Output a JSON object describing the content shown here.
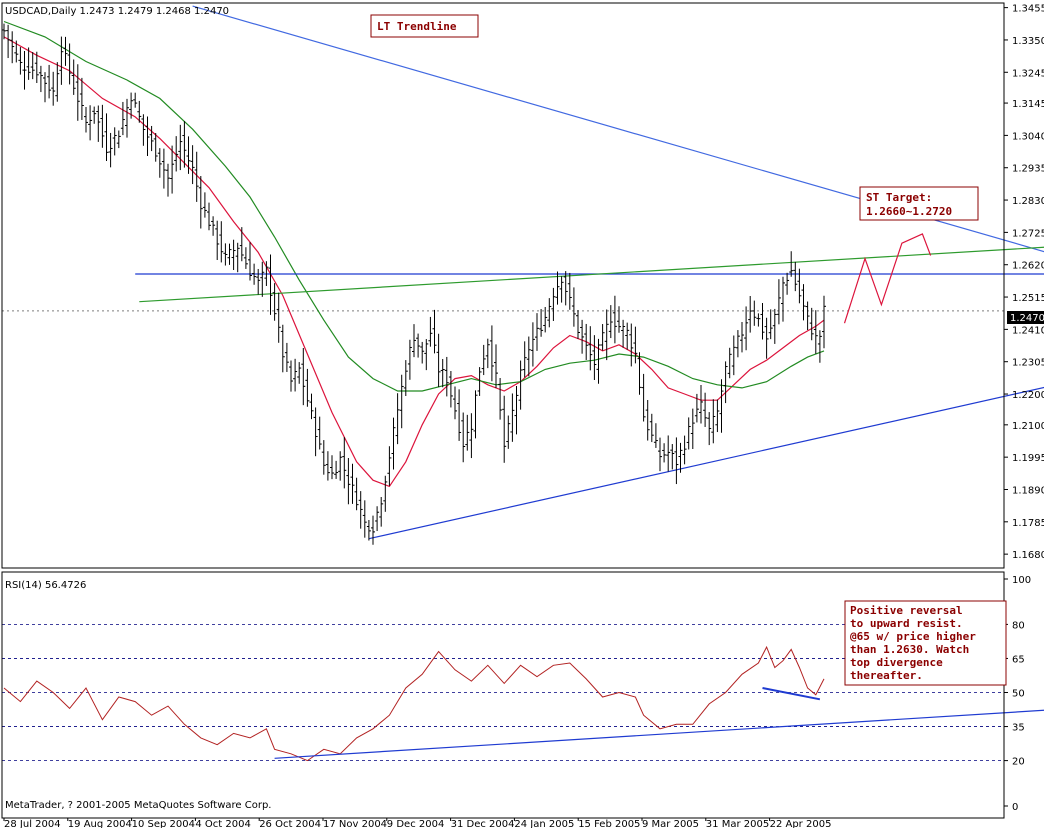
{
  "price_header": "USDCAD,Daily  1.2473 1.2479 1.2468 1.2470",
  "rsi_header": "RSI(14) 56.4726",
  "copyright": "MetaTrader, ? 2001-2005 MetaQuotes Software Corp.",
  "price_marker": "1.2470",
  "annotations": {
    "lt_trendline": "LT Trendline",
    "st_target_1": "ST Target:",
    "st_target_2": "1.2660~1.2720",
    "rsi_note": [
      "Positive reversal",
      "to upward resist.",
      "@65 w/ price higher",
      "than 1.2630. Watch",
      "top divergence",
      "thereafter."
    ]
  },
  "colors": {
    "frame": "#000000",
    "bars": "#000000",
    "ma_fast": "#dc143c",
    "ma_slow": "#228b22",
    "trend_blue": "#1f3bd1",
    "trend_lt": "#4169e1",
    "resist_green": "#2e9b2e",
    "rsi_line": "#b22222",
    "ann_border": "#8b0000",
    "ann_text": "#8b0000",
    "grid": "#00007f"
  },
  "chart_data": [
    {
      "type": "candlestick",
      "title": "USDCAD,Daily",
      "ohlc_readout": [
        1.2473,
        1.2479,
        1.2468,
        1.247
      ],
      "x_tick_labels": [
        "28 Jul 2004",
        "19 Aug 2004",
        "10 Sep 2004",
        "4 Oct 2004",
        "26 Oct 2004",
        "17 Nov 2004",
        "9 Dec 2004",
        "31 Dec 2004",
        "24 Jan 2005",
        "15 Feb 2005",
        "9 Mar 2005",
        "31 Mar 2005",
        "22 Apr 2005"
      ],
      "y_tick_labels": [
        "1.3455",
        "1.3350",
        "1.3245",
        "1.3145",
        "1.3040",
        "1.2935",
        "1.2830",
        "1.2725",
        "1.2620",
        "1.2515",
        "1.2410",
        "1.2305",
        "1.2200",
        "1.2100",
        "1.1995",
        "1.1890",
        "1.1785",
        "1.1680"
      ],
      "ylim": [
        1.1635,
        1.347
      ],
      "grid": true,
      "close_path": [
        [
          0,
          1.338
        ],
        [
          4,
          1.327
        ],
        [
          8,
          1.325
        ],
        [
          12,
          1.318
        ],
        [
          14,
          1.333
        ],
        [
          18,
          1.316
        ],
        [
          20,
          1.308
        ],
        [
          22,
          1.312
        ],
        [
          25,
          1.3
        ],
        [
          28,
          1.305
        ],
        [
          31,
          1.317
        ],
        [
          34,
          1.306
        ],
        [
          37,
          1.299
        ],
        [
          40,
          1.29
        ],
        [
          43,
          1.302
        ],
        [
          46,
          1.293
        ],
        [
          48,
          1.282
        ],
        [
          51,
          1.273
        ],
        [
          54,
          1.264
        ],
        [
          57,
          1.268
        ],
        [
          60,
          1.26
        ],
        [
          62,
          1.256
        ],
        [
          64,
          1.26
        ],
        [
          66,
          1.247
        ],
        [
          68,
          1.233
        ],
        [
          70,
          1.224
        ],
        [
          72,
          1.228
        ],
        [
          74,
          1.218
        ],
        [
          76,
          1.208
        ],
        [
          78,
          1.197
        ],
        [
          80,
          1.194
        ],
        [
          82,
          1.199
        ],
        [
          84,
          1.192
        ],
        [
          86,
          1.186
        ],
        [
          88,
          1.178
        ],
        [
          90,
          1.177
        ],
        [
          92,
          1.186
        ],
        [
          94,
          1.2
        ],
        [
          96,
          1.215
        ],
        [
          98,
          1.229
        ],
        [
          100,
          1.239
        ],
        [
          102,
          1.233
        ],
        [
          104,
          1.24
        ],
        [
          106,
          1.228
        ],
        [
          108,
          1.225
        ],
        [
          110,
          1.215
        ],
        [
          112,
          1.204
        ],
        [
          114,
          1.21
        ],
        [
          116,
          1.228
        ],
        [
          118,
          1.237
        ],
        [
          120,
          1.225
        ],
        [
          122,
          1.203
        ],
        [
          124,
          1.214
        ],
        [
          126,
          1.226
        ],
        [
          128,
          1.235
        ],
        [
          130,
          1.24
        ],
        [
          132,
          1.245
        ],
        [
          134,
          1.253
        ],
        [
          136,
          1.258
        ],
        [
          138,
          1.25
        ],
        [
          140,
          1.241
        ],
        [
          142,
          1.235
        ],
        [
          144,
          1.23
        ],
        [
          146,
          1.238
        ],
        [
          148,
          1.245
        ],
        [
          150,
          1.242
        ],
        [
          152,
          1.24
        ],
        [
          154,
          1.233
        ],
        [
          156,
          1.213
        ],
        [
          158,
          1.206
        ],
        [
          160,
          1.2
        ],
        [
          162,
          1.201
        ],
        [
          164,
          1.198
        ],
        [
          166,
          1.204
        ],
        [
          168,
          1.212
        ],
        [
          170,
          1.216
        ],
        [
          172,
          1.208
        ],
        [
          174,
          1.214
        ],
        [
          176,
          1.228
        ],
        [
          178,
          1.234
        ],
        [
          180,
          1.24
        ],
        [
          182,
          1.248
        ],
        [
          184,
          1.244
        ],
        [
          186,
          1.238
        ],
        [
          188,
          1.245
        ],
        [
          190,
          1.256
        ],
        [
          192,
          1.26
        ],
        [
          194,
          1.252
        ],
        [
          196,
          1.244
        ],
        [
          198,
          1.238
        ],
        [
          199,
          1.239
        ],
        [
          200,
          1.247
        ]
      ],
      "series": [
        {
          "name": "MA fast",
          "color": "ma_fast",
          "values": [
            [
              0,
              1.336
            ],
            [
              8,
              1.33
            ],
            [
              16,
              1.325
            ],
            [
              24,
              1.316
            ],
            [
              32,
              1.31
            ],
            [
              38,
              1.303
            ],
            [
              44,
              1.295
            ],
            [
              50,
              1.287
            ],
            [
              56,
              1.276
            ],
            [
              62,
              1.266
            ],
            [
              68,
              1.252
            ],
            [
              74,
              1.233
            ],
            [
              80,
              1.214
            ],
            [
              86,
              1.198
            ],
            [
              90,
              1.192
            ],
            [
              94,
              1.19
            ],
            [
              98,
              1.198
            ],
            [
              102,
              1.21
            ],
            [
              106,
              1.22
            ],
            [
              110,
              1.225
            ],
            [
              114,
              1.226
            ],
            [
              118,
              1.223
            ],
            [
              122,
              1.221
            ],
            [
              126,
              1.224
            ],
            [
              130,
              1.229
            ],
            [
              134,
              1.235
            ],
            [
              138,
              1.239
            ],
            [
              142,
              1.237
            ],
            [
              146,
              1.234
            ],
            [
              150,
              1.236
            ],
            [
              154,
              1.233
            ],
            [
              158,
              1.228
            ],
            [
              162,
              1.222
            ],
            [
              166,
              1.22
            ],
            [
              170,
              1.218
            ],
            [
              174,
              1.218
            ],
            [
              178,
              1.223
            ],
            [
              182,
              1.228
            ],
            [
              186,
              1.231
            ],
            [
              190,
              1.235
            ],
            [
              194,
              1.239
            ],
            [
              198,
              1.242
            ],
            [
              200,
              1.244
            ]
          ]
        },
        {
          "name": "MA slow",
          "color": "ma_slow",
          "values": [
            [
              0,
              1.341
            ],
            [
              10,
              1.336
            ],
            [
              20,
              1.328
            ],
            [
              30,
              1.322
            ],
            [
              38,
              1.316
            ],
            [
              46,
              1.306
            ],
            [
              54,
              1.294
            ],
            [
              60,
              1.284
            ],
            [
              66,
              1.271
            ],
            [
              72,
              1.257
            ],
            [
              78,
              1.244
            ],
            [
              84,
              1.232
            ],
            [
              90,
              1.225
            ],
            [
              96,
              1.221
            ],
            [
              102,
              1.221
            ],
            [
              108,
              1.223
            ],
            [
              114,
              1.225
            ],
            [
              120,
              1.223
            ],
            [
              126,
              1.224
            ],
            [
              132,
              1.228
            ],
            [
              138,
              1.23
            ],
            [
              144,
              1.231
            ],
            [
              150,
              1.233
            ],
            [
              156,
              1.232
            ],
            [
              162,
              1.229
            ],
            [
              168,
              1.225
            ],
            [
              174,
              1.223
            ],
            [
              180,
              1.222
            ],
            [
              186,
              1.224
            ],
            [
              192,
              1.229
            ],
            [
              196,
              1.232
            ],
            [
              200,
              1.234
            ]
          ]
        },
        {
          "name": "LT Trendline",
          "color": "trend_lt",
          "values": [
            [
              46,
              1.346
            ],
            [
              270,
              1.26
            ]
          ]
        },
        {
          "name": "resistance line",
          "color": "trend_blue",
          "values": [
            [
              32,
              1.259
            ],
            [
              270,
              1.259
            ]
          ]
        },
        {
          "name": "rising resistance",
          "color": "resist_green",
          "values": [
            [
              33,
              1.25
            ],
            [
              270,
              1.269
            ]
          ]
        },
        {
          "name": "support trendline",
          "color": "trend_blue",
          "values": [
            [
              89,
              1.173
            ],
            [
              270,
              1.227
            ]
          ]
        },
        {
          "name": "projection",
          "color": "ma_fast",
          "values": [
            [
              205,
              1.243
            ],
            [
              210,
              1.264
            ],
            [
              214,
              1.249
            ],
            [
              219,
              1.269
            ],
            [
              224,
              1.272
            ],
            [
              226,
              1.265
            ]
          ]
        }
      ]
    },
    {
      "type": "line",
      "title": "RSI(14) 56.4726",
      "y_tick_labels": [
        "100",
        "80",
        "65",
        "50",
        "35",
        "20",
        "0"
      ],
      "ylim": [
        0,
        100
      ],
      "grid": true,
      "levels": [
        80,
        65,
        50,
        35,
        20
      ],
      "series": [
        {
          "name": "RSI(14)",
          "values": [
            [
              0,
              52
            ],
            [
              4,
              46
            ],
            [
              8,
              55
            ],
            [
              12,
              50
            ],
            [
              16,
              43
            ],
            [
              20,
              52
            ],
            [
              24,
              38
            ],
            [
              28,
              48
            ],
            [
              32,
              46
            ],
            [
              36,
              40
            ],
            [
              40,
              44
            ],
            [
              44,
              36
            ],
            [
              48,
              30
            ],
            [
              52,
              27
            ],
            [
              56,
              32
            ],
            [
              60,
              30
            ],
            [
              64,
              34
            ],
            [
              66,
              25
            ],
            [
              70,
              23
            ],
            [
              74,
              20
            ],
            [
              78,
              25
            ],
            [
              82,
              23
            ],
            [
              86,
              30
            ],
            [
              90,
              34
            ],
            [
              94,
              40
            ],
            [
              98,
              52
            ],
            [
              102,
              58
            ],
            [
              106,
              68
            ],
            [
              110,
              60
            ],
            [
              114,
              55
            ],
            [
              118,
              62
            ],
            [
              122,
              54
            ],
            [
              126,
              62
            ],
            [
              130,
              57
            ],
            [
              134,
              62
            ],
            [
              138,
              63
            ],
            [
              142,
              56
            ],
            [
              146,
              48
            ],
            [
              150,
              50
            ],
            [
              154,
              48
            ],
            [
              156,
              40
            ],
            [
              160,
              34
            ],
            [
              164,
              36
            ],
            [
              168,
              36
            ],
            [
              172,
              45
            ],
            [
              176,
              50
            ],
            [
              180,
              58
            ],
            [
              184,
              63
            ],
            [
              186,
              70
            ],
            [
              188,
              61
            ],
            [
              190,
              64
            ],
            [
              192,
              69
            ],
            [
              194,
              61
            ],
            [
              196,
              52
            ],
            [
              198,
              49
            ],
            [
              200,
              56
            ]
          ]
        },
        {
          "name": "RSI support",
          "values": [
            [
              66,
              21
            ],
            [
              270,
              44
            ]
          ]
        },
        {
          "name": "RSI divergence",
          "values": [
            [
              185,
              52
            ],
            [
              199,
              47
            ]
          ]
        }
      ]
    }
  ]
}
